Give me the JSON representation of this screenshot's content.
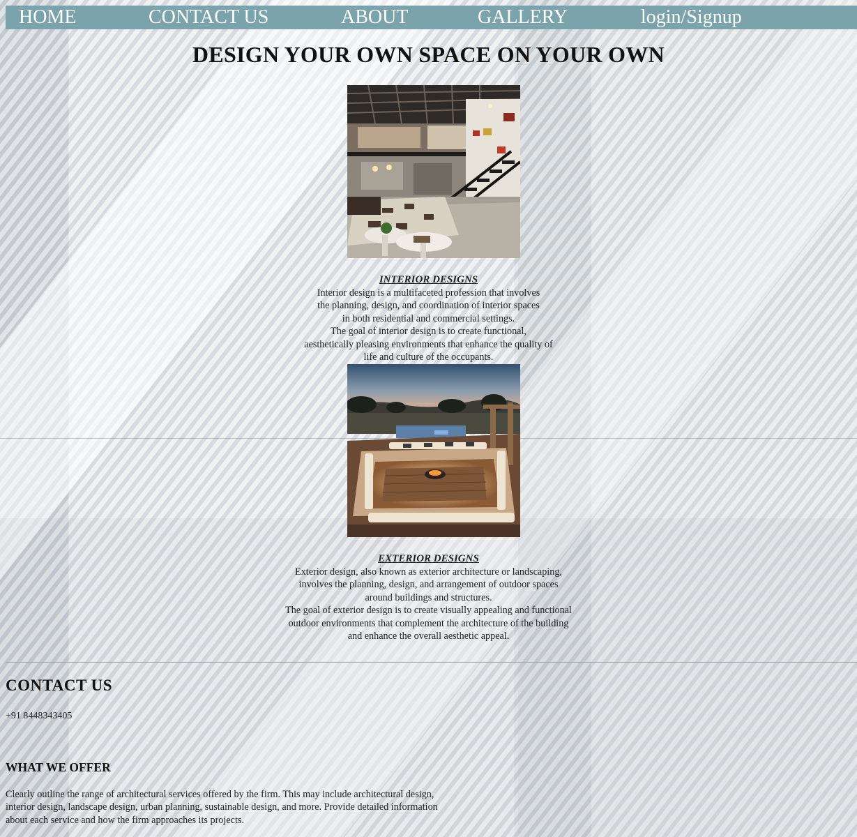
{
  "nav": {
    "home": "HOME",
    "contact": "CONTACT US",
    "about": "ABOUT",
    "gallery": "GALLERY",
    "login": "login/Signup"
  },
  "page_title": "DESIGN YOUR OWN SPACE ON YOUR OWN",
  "interior": {
    "title": "INTERIOR DESIGNS",
    "lines": [
      "Interior design is a multifaceted profession that involves",
      "the planning, design, and coordination of interior spaces",
      "in both residential and commercial settings.",
      "The goal of interior design is to create functional,",
      "aesthetically pleasing environments that enhance the quality of",
      "life and culture of the occupants."
    ]
  },
  "exterior": {
    "title": "EXTERIOR DESIGNS",
    "lines": [
      "Exterior design, also known as exterior architecture or landscaping,",
      "involves the planning, design, and arrangement of outdoor spaces",
      "around buildings and structures.",
      "The goal of exterior design is to create visually appealing and functional",
      "outdoor environments that complement the architecture of the building",
      "and enhance the overall aesthetic appeal."
    ]
  },
  "contact": {
    "heading": "CONTACT US",
    "phone": "+91 8448343405"
  },
  "offer": {
    "heading": "WHAT WE OFFER",
    "lines": [
      "Clearly outline the range of architectural services offered by the firm. This may include architectural design,",
      "interior design, landscape design, urban planning, sustainable design, and more. Provide detailed information",
      "about each service and how the firm approaches its projects."
    ]
  },
  "colors": {
    "nav_bar": "#7aa3ab",
    "nav_text": "#ffffff"
  }
}
